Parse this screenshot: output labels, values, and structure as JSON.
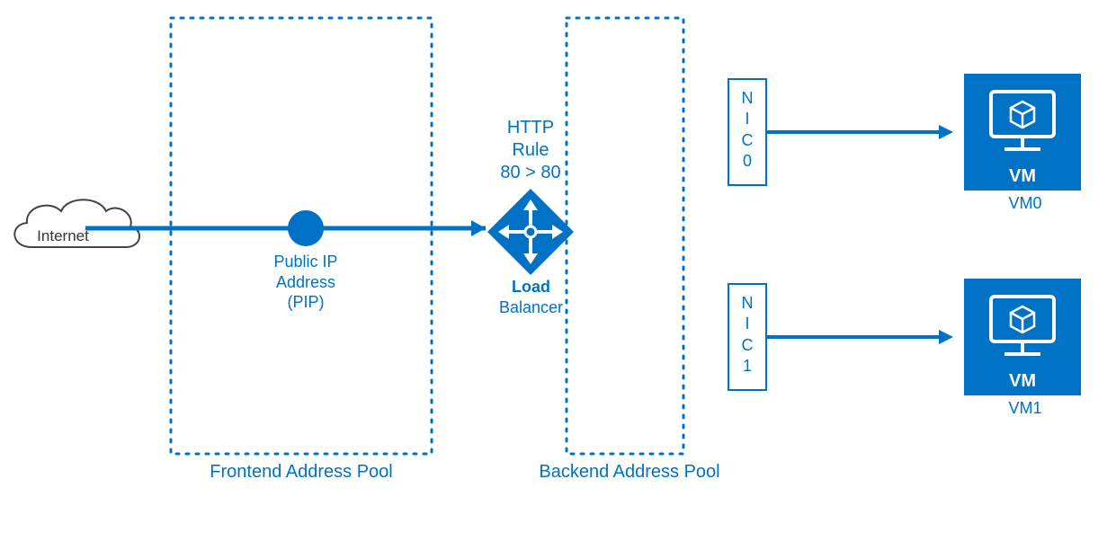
{
  "internet_label": "Internet",
  "frontend_pool_label": "Frontend Address Pool",
  "public_ip_line1": "Public IP",
  "public_ip_line2": "Address",
  "public_ip_line3": "(PIP)",
  "http_rule_line1": "HTTP",
  "http_rule_line2": "Rule",
  "http_rule_line3": "80 > 80",
  "load_balancer_line1": "Load",
  "load_balancer_line2": "Balancer",
  "backend_pool_label": "Backend Address Pool",
  "nic0_label": "N\nI\nC\n0",
  "nic1_label": "N\nI\nC\n1",
  "vm_badge": "VM",
  "vm0_label": "VM0",
  "vm1_label": "VM1"
}
